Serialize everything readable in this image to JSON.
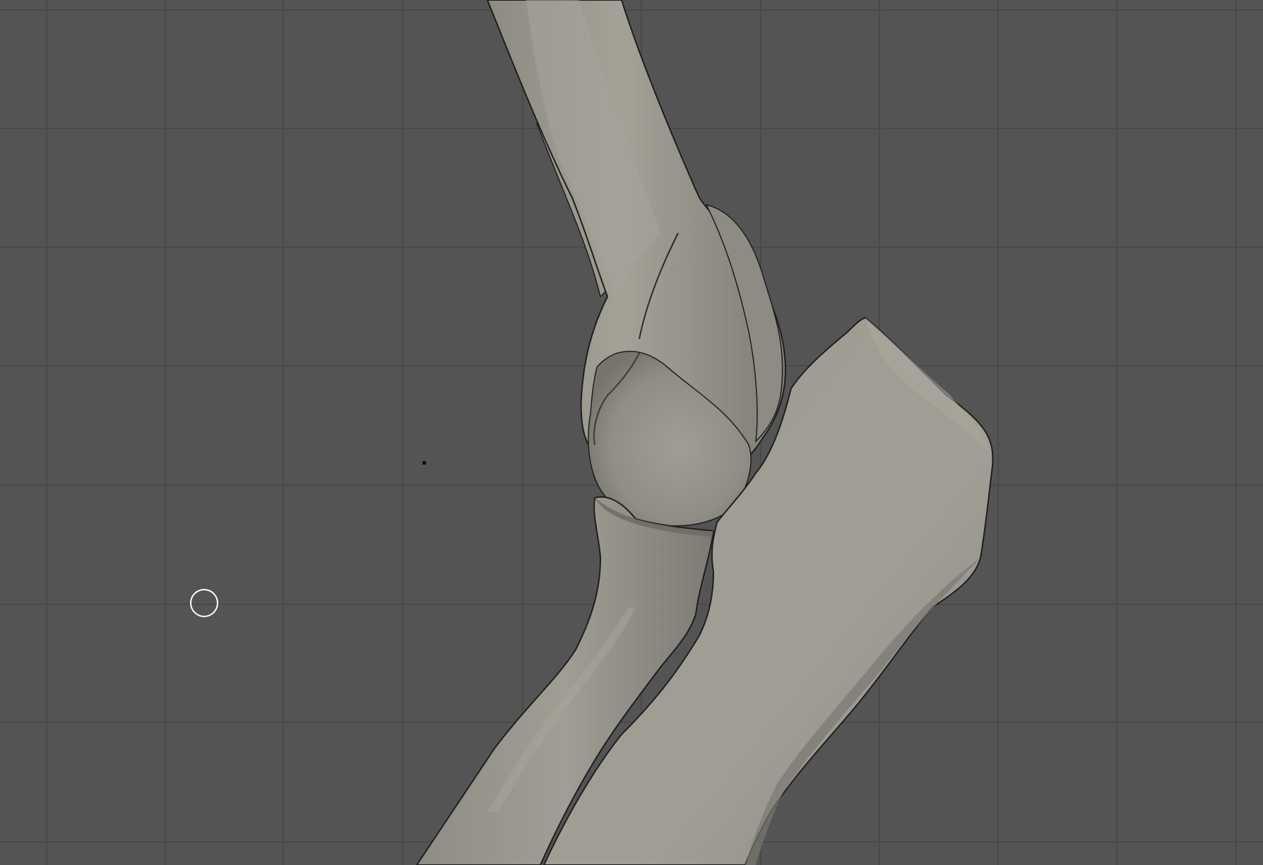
{
  "app": {
    "view": "3d-viewport",
    "shading": "solid"
  },
  "viewport": {
    "grid_visible": true,
    "colors": {
      "background": "#545454",
      "grid_line": "#4a4a4a",
      "mesh_light": "#a3a196",
      "mesh_mid": "#94928a",
      "mesh_dark": "#6f6e68",
      "outline": "#1e1e1e"
    },
    "objects": [
      {
        "name": "humerus",
        "type": "mesh"
      },
      {
        "name": "radius",
        "type": "mesh"
      },
      {
        "name": "ulna",
        "type": "mesh"
      }
    ],
    "cursor": {
      "icon": "3d-cursor-icon"
    },
    "origin": {
      "icon": "object-origin-icon"
    }
  }
}
